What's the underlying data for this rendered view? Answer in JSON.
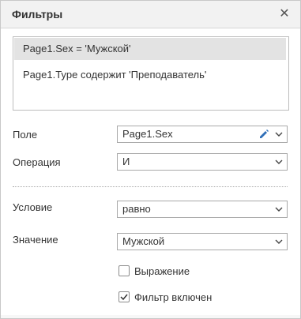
{
  "dialog": {
    "title": "Фильтры",
    "close_icon": "close-icon"
  },
  "filters": [
    {
      "text": "Page1.Sex = 'Мужской'",
      "selected": true
    },
    {
      "text": "Page1.Type содержит 'Преподаватель'",
      "selected": false
    }
  ],
  "form": {
    "field_label": "Поле",
    "field_value": "Page1.Sex",
    "operation_label": "Операция",
    "operation_value": "И",
    "condition_label": "Условие",
    "condition_value": "равно",
    "value_label": "Значение",
    "value_value": "Мужской"
  },
  "checkboxes": {
    "expression_label": "Выражение",
    "expression_checked": false,
    "enabled_label": "Фильтр включен",
    "enabled_checked": true
  },
  "colors": {
    "selected_row": "#e3e3e3",
    "header_bg": "#f2f2f2",
    "pencil": "#2f6fb8"
  }
}
